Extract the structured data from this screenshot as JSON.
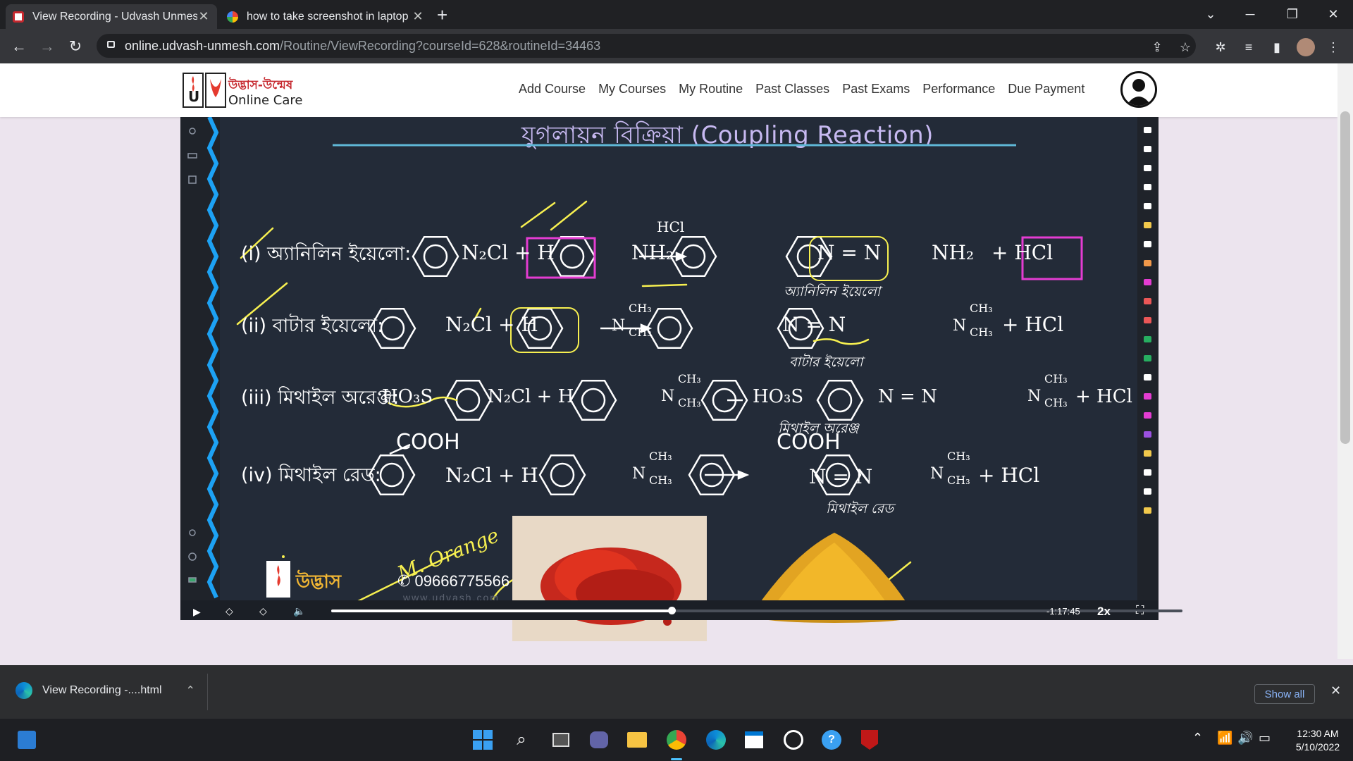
{
  "browser": {
    "tabs": [
      {
        "title": "View Recording - Udvash Unmes",
        "active": true
      },
      {
        "title": "how to take screenshot in laptop",
        "active": false
      }
    ],
    "url_host": "online.udvash-unmesh.com",
    "url_path": "/Routine/ViewRecording?courseId=628&routineId=34463"
  },
  "site": {
    "nav": [
      "Add Course",
      "My Courses",
      "My Routine",
      "Past Classes",
      "Past Exams",
      "Performance",
      "Due Payment"
    ],
    "logo_text": [
      "উদ্ভাস-উন্মেষ",
      "Online Care"
    ]
  },
  "lesson": {
    "title": "যুগলায়ন বিক্রিয়া (Coupling Reaction)",
    "rows": [
      {
        "label": "(i) অ্যানিলিন ইয়েলো:",
        "product_name": "অ্যানিলিন ইয়েলো"
      },
      {
        "label": "(ii) বাটার ইয়েলো:",
        "product_name": "বাটার ইয়েলো"
      },
      {
        "label": "(iii) মিথাইল অরেঞ্জ:",
        "product_name": "মিথাইল অরেঞ্জ"
      },
      {
        "label": "(iv) মিথাইল রেড:",
        "product_name": "মিথাইল রেড"
      }
    ],
    "reagents": {
      "n2cl_h": "N₂Cl + H",
      "nh2": "NH₂",
      "hcl_above": "HCl",
      "azo": "N = N",
      "plus_hcl": "+ HCl",
      "ch3": "CH₃",
      "ho3s": "HO₃S",
      "cooh": "COOH",
      "cooh_cut": "COOH"
    },
    "handwriting": "M. Orange",
    "brand_text": "উদ্ভাস",
    "phone": "09666775566",
    "watermark": "www.udvash.com"
  },
  "player": {
    "remaining": "-1:17:45",
    "speed": "2x",
    "progress": 0.4
  },
  "downloads": {
    "file": "View Recording -....html",
    "show_all": "Show all"
  },
  "taskbar": {
    "time": "12:30 AM",
    "date": "5/10/2022"
  }
}
